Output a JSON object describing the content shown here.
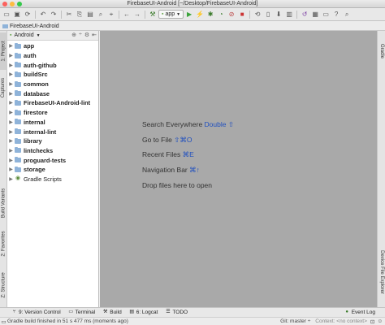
{
  "window": {
    "title": "FirebaseUI-Android [~/Desktop/FirebaseUI-Android]"
  },
  "toolbar": {
    "run_config": "app"
  },
  "breadcrumb": {
    "project": "FirebaseUI-Android"
  },
  "project_panel": {
    "view_mode": "Android",
    "items": [
      {
        "label": "app",
        "bold": true
      },
      {
        "label": "auth",
        "bold": true
      },
      {
        "label": "auth-github",
        "bold": true
      },
      {
        "label": "buildSrc",
        "bold": true
      },
      {
        "label": "common",
        "bold": true
      },
      {
        "label": "database",
        "bold": true
      },
      {
        "label": "FirebaseUI-Android-lint",
        "bold": true
      },
      {
        "label": "firestore",
        "bold": true
      },
      {
        "label": "internal",
        "bold": true
      },
      {
        "label": "internal-lint",
        "bold": true
      },
      {
        "label": "library",
        "bold": true
      },
      {
        "label": "lintchecks",
        "bold": true
      },
      {
        "label": "proguard-tests",
        "bold": true
      },
      {
        "label": "storage",
        "bold": true
      },
      {
        "label": "Gradle Scripts",
        "bold": false
      }
    ]
  },
  "left_tabs": {
    "project": "1: Project",
    "captures": "Captures",
    "build_variants": "Build Variants",
    "favorites": "2: Favorites",
    "structure": "Z: Structure"
  },
  "right_tabs": {
    "gradle": "Gradle",
    "device_file_explorer": "Device File Explorer"
  },
  "editor_hints": [
    {
      "text": "Search Everywhere ",
      "key": "Double ⇧"
    },
    {
      "text": "Go to File ",
      "key": "⇧⌘O"
    },
    {
      "text": "Recent Files ",
      "key": "⌘E"
    },
    {
      "text": "Navigation Bar ",
      "key": "⌘↑"
    },
    {
      "text": "Drop files here to open",
      "key": ""
    }
  ],
  "bottom_tabs": {
    "version_control": "9: Version Control",
    "terminal": "Terminal",
    "build": "Build",
    "logcat": "6: Logcat",
    "todo": "TODO",
    "event_log": "Event Log"
  },
  "status": {
    "message": "Gradle build finished in 51 s 477 ms (moments ago)",
    "git": "Git: master ÷",
    "context": "Context: <no context>"
  },
  "colors": {
    "editor_bg": "#a9a9a9",
    "folder": "#8fb3d9",
    "shortcut": "#1f4fbf"
  }
}
